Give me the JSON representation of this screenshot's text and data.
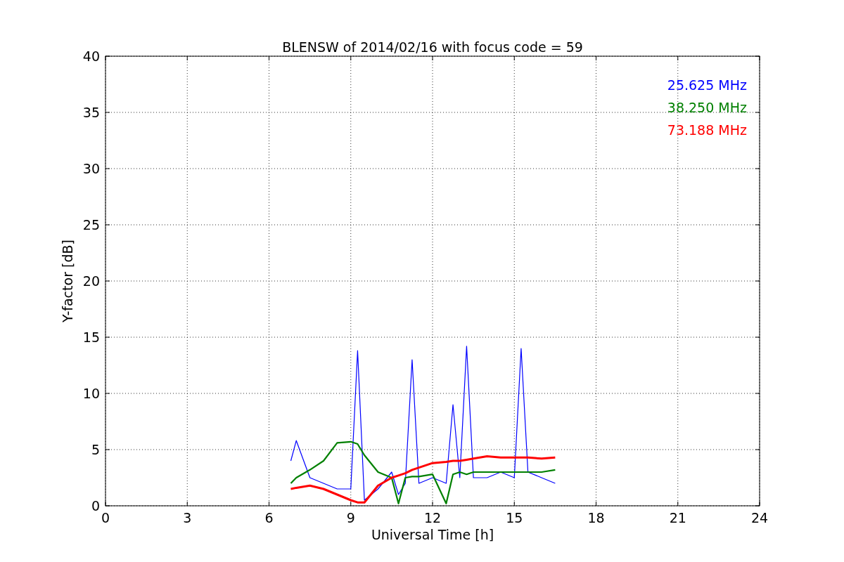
{
  "figure": {
    "chart_data": {
      "type": "line",
      "title": "BLENSW of 2014/02/16 with focus code = 59",
      "xlabel": "Universal Time [h]",
      "ylabel": "Y-factor [dB]",
      "x": [
        6.8,
        7,
        7.5,
        8,
        8.5,
        9,
        9.25,
        9.5,
        10,
        10.5,
        10.75,
        11,
        11.25,
        11.5,
        12,
        12.5,
        12.75,
        13,
        13.25,
        13.5,
        14,
        14.5,
        15,
        15.25,
        15.5,
        16,
        16.5
      ],
      "series": [
        {
          "name": "25.625 MHz",
          "color": "#0000ff",
          "values": [
            4,
            5.8,
            2.5,
            2,
            1.5,
            1.5,
            13.8,
            0.5,
            1.5,
            3,
            1,
            2,
            13,
            2,
            2.5,
            2,
            9,
            2.5,
            14.2,
            2.5,
            2.5,
            3,
            2.5,
            14,
            3,
            2.5,
            2
          ]
        },
        {
          "name": "38.250 MHz",
          "color": "#008000",
          "values": [
            2,
            2.5,
            3.2,
            4,
            5.6,
            5.7,
            5.5,
            4.5,
            3,
            2.5,
            0.2,
            2.5,
            2.6,
            2.6,
            2.8,
            0.2,
            2.8,
            3,
            2.8,
            3,
            3,
            3,
            3,
            3,
            3,
            3,
            3.2
          ]
        },
        {
          "name": "73.188 MHz",
          "color": "#ff0000",
          "values": [
            1.5,
            1.6,
            1.8,
            1.5,
            1,
            0.5,
            0.3,
            0.3,
            1.8,
            2.5,
            2.7,
            2.9,
            3.2,
            3.4,
            3.8,
            3.9,
            4,
            4,
            4.1,
            4.2,
            4.4,
            4.3,
            4.3,
            4.3,
            4.3,
            4.2,
            4.3
          ]
        }
      ],
      "xlim": [
        0,
        24
      ],
      "ylim": [
        0,
        40
      ],
      "xticks": [
        0,
        3,
        6,
        9,
        12,
        15,
        18,
        21,
        24
      ],
      "yticks": [
        0,
        5,
        10,
        15,
        20,
        25,
        30,
        35,
        40
      ],
      "grid": true
    }
  }
}
